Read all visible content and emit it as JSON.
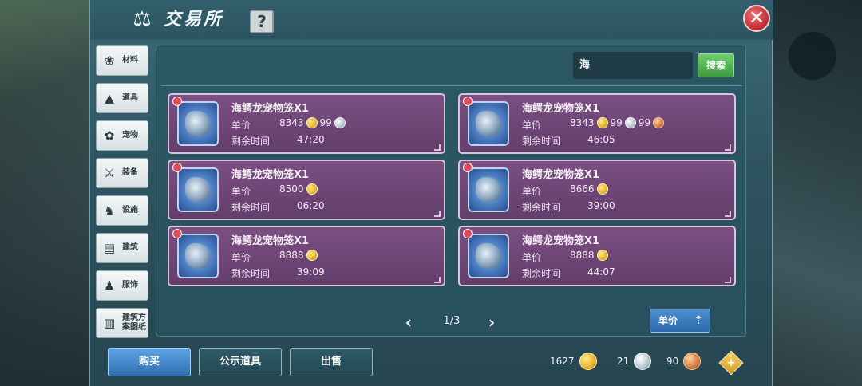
{
  "header": {
    "title": "交易所",
    "help_label": "?",
    "close_label": "✕"
  },
  "sidebar": {
    "items": [
      {
        "label": "材料",
        "icon": "materials-icon",
        "glyph": "❀"
      },
      {
        "label": "道具",
        "icon": "items-icon",
        "glyph": "▲"
      },
      {
        "label": "宠物",
        "icon": "pets-icon",
        "glyph": "✿"
      },
      {
        "label": "装备",
        "icon": "equipment-icon",
        "glyph": "⚔"
      },
      {
        "label": "设施",
        "icon": "facility-icon",
        "glyph": "♞"
      },
      {
        "label": "建筑",
        "icon": "building-icon",
        "glyph": "▤"
      },
      {
        "label": "服饰",
        "icon": "clothing-icon",
        "glyph": "♟"
      },
      {
        "label": "建筑方案图纸",
        "icon": "blueprint-icon",
        "glyph": "▥"
      }
    ]
  },
  "search": {
    "value": "海",
    "button_label": "搜索"
  },
  "listings": [
    {
      "name": "海鳄龙宠物笼X1",
      "price_label": "单价",
      "gold": "8343",
      "silver": "99",
      "copper": "",
      "time_label": "剩余时间",
      "time": "47:20"
    },
    {
      "name": "海鳄龙宠物笼X1",
      "price_label": "单价",
      "gold": "8343",
      "silver": "99",
      "copper": "99",
      "time_label": "剩余时间",
      "time": "46:05"
    },
    {
      "name": "海鳄龙宠物笼X1",
      "price_label": "单价",
      "gold": "8500",
      "silver": "",
      "copper": "",
      "time_label": "剩余时间",
      "time": "06:20"
    },
    {
      "name": "海鳄龙宠物笼X1",
      "price_label": "单价",
      "gold": "8666",
      "silver": "",
      "copper": "",
      "time_label": "剩余时间",
      "time": "39:00"
    },
    {
      "name": "海鳄龙宠物笼X1",
      "price_label": "单价",
      "gold": "8888",
      "silver": "",
      "copper": "",
      "time_label": "剩余时间",
      "time": "39:09"
    },
    {
      "name": "海鳄龙宠物笼X1",
      "price_label": "单价",
      "gold": "8888",
      "silver": "",
      "copper": "",
      "time_label": "剩余时间",
      "time": "44:07"
    }
  ],
  "pager": {
    "prev": "‹",
    "text": "1/3",
    "next": "›"
  },
  "sort": {
    "label": "单价",
    "arrow": "⇡"
  },
  "bottom": {
    "buy_label": "购买",
    "public_label": "公示道具",
    "sell_label": "出售",
    "gold": "1627",
    "silver": "21",
    "copper": "90",
    "add_label": "+"
  }
}
